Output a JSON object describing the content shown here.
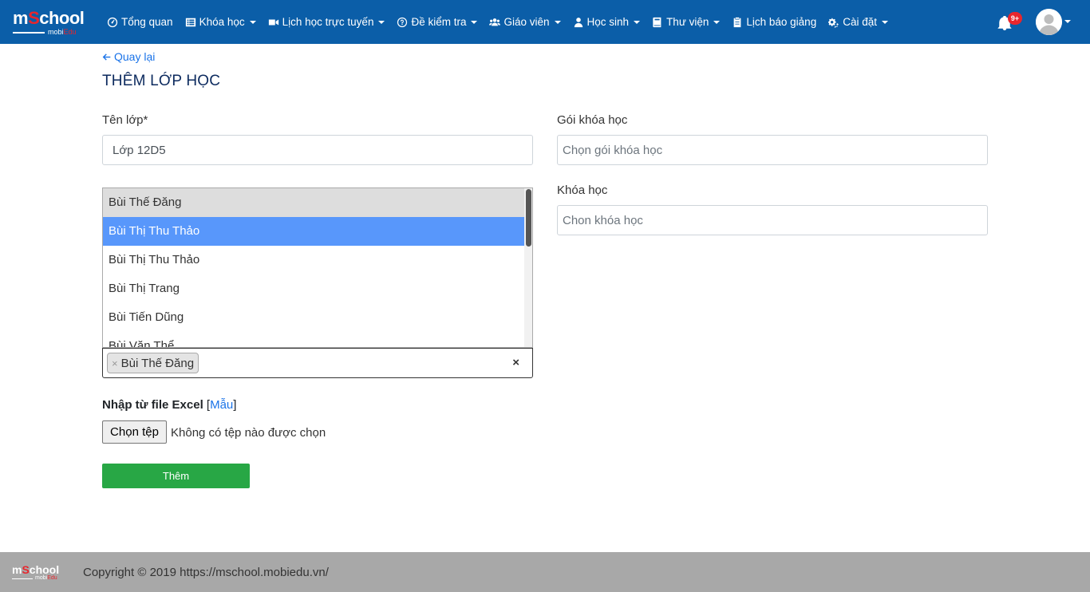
{
  "brand": {
    "name_pre": "m",
    "name_accent": "S",
    "name_post": "chool",
    "sub_pre": "mobi",
    "sub_accent": "Edu"
  },
  "nav": [
    {
      "label": "Tổng quan",
      "icon": "dashboard-icon",
      "caret": false
    },
    {
      "label": "Khóa học",
      "icon": "list-icon",
      "caret": true
    },
    {
      "label": "Lịch học trực tuyến",
      "icon": "video-icon",
      "caret": true
    },
    {
      "label": "Đề kiểm tra",
      "icon": "question-circle-icon",
      "caret": true
    },
    {
      "label": "Giáo viên",
      "icon": "users-icon",
      "caret": true
    },
    {
      "label": "Học sinh",
      "icon": "user-icon",
      "caret": true
    },
    {
      "label": "Thư viện",
      "icon": "book-icon",
      "caret": true
    },
    {
      "label": "Lịch báo giảng",
      "icon": "clipboard-icon",
      "caret": false
    },
    {
      "label": "Cài đặt",
      "icon": "gears-icon",
      "caret": true
    }
  ],
  "notifications": {
    "badge": "9+"
  },
  "back_label": "Quay lại",
  "page_title": "THÊM LỚP HỌC",
  "form": {
    "class_name_label": "Tên lớp*",
    "class_name_value": "Lớp 12D5",
    "package_label": "Gói khóa học",
    "package_placeholder": "Chọn gói khóa học",
    "course_label": "Khóa học",
    "course_placeholder": "Chon khóa học",
    "dropdown_options": [
      "Bùi Thế Đăng",
      "Bùi Thị Thu Thảo",
      "Bùi Thị Thu Thảo",
      "Bùi Thị Trang",
      "Bùi Tiến Dũng",
      "Bùi Văn Thể"
    ],
    "selected_chip": "Bùi Thế Đăng",
    "chip_remove": "×",
    "clear_all": "×",
    "excel_label": "Nhập từ file Excel",
    "excel_link": "Mẫu",
    "file_button": "Chọn tệp",
    "file_status": "Không có tệp nào được chọn",
    "submit_label": "Thêm"
  },
  "footer": {
    "copyright": "Copyright © 2019 https://mschool.mobiedu.vn/"
  },
  "colors": {
    "navbar": "#0b5ea8",
    "accent": "#e8262d",
    "submit": "#28a745",
    "selected_option": "#5897fb",
    "footer": "#a8a8a8"
  }
}
